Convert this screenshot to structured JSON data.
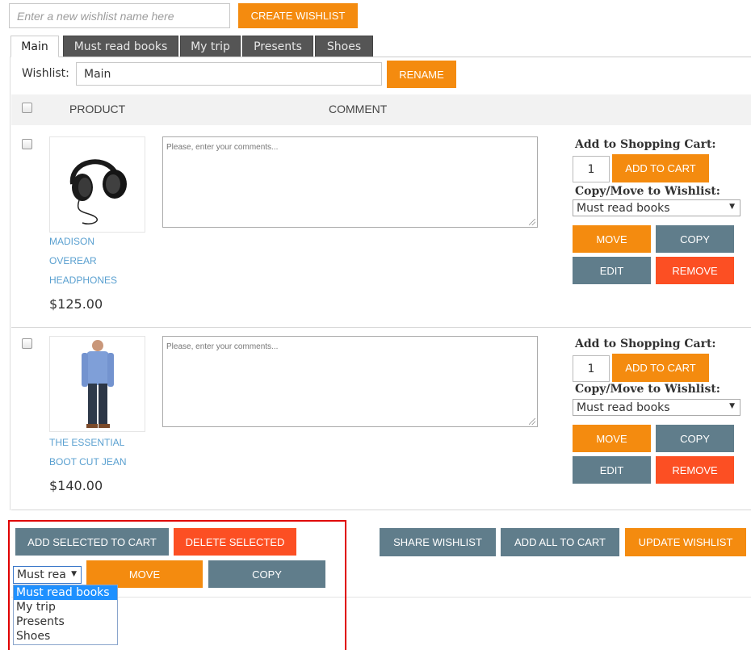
{
  "new_wishlist": {
    "placeholder": "Enter a new wishlist name here",
    "create_label": "CREATE WISHLIST"
  },
  "tabs": [
    "Main",
    "Must read books",
    "My trip",
    "Presents",
    "Shoes"
  ],
  "wishlist": {
    "label": "Wishlist:",
    "name": "Main",
    "rename_label": "RENAME"
  },
  "table_header": {
    "product": "PRODUCT",
    "comment": "COMMENT"
  },
  "items": [
    {
      "name_lines": [
        "MADISON",
        "OVEREAR",
        "HEADPHONES"
      ],
      "price": "$125.00",
      "comment_placeholder": "Please, enter your comments...",
      "add_to_cart_heading": "Add to Shopping Cart:",
      "qty": "1",
      "add_to_cart_label": "ADD TO CART",
      "copy_move_heading": "Copy/Move to Wishlist:",
      "target_wishlist": "Must read books",
      "move_label": "MOVE",
      "copy_label": "COPY",
      "edit_label": "EDIT",
      "remove_label": "REMOVE",
      "image_icon": "headphones-icon"
    },
    {
      "name_lines": [
        "THE ESSENTIAL",
        "BOOT CUT JEAN"
      ],
      "price": "$140.00",
      "comment_placeholder": "Please, enter your comments...",
      "add_to_cart_heading": "Add to Shopping Cart:",
      "qty": "1",
      "add_to_cart_label": "ADD TO CART",
      "copy_move_heading": "Copy/Move to Wishlist:",
      "target_wishlist": "Must read books",
      "move_label": "MOVE",
      "copy_label": "COPY",
      "edit_label": "EDIT",
      "remove_label": "REMOVE",
      "image_icon": "man-in-jeans-icon"
    }
  ],
  "bulk_actions": {
    "add_selected": "ADD SELECTED TO CART",
    "delete_selected": "DELETE SELECTED",
    "share": "SHARE WISHLIST",
    "add_all": "ADD ALL TO CART",
    "update": "UPDATE WISHLIST",
    "select_value": "Must rea",
    "move_label": "MOVE",
    "copy_label": "COPY",
    "dropdown_options": [
      "Must read books",
      "My trip",
      "Presents",
      "Shoes"
    ]
  },
  "colors": {
    "orange": "#f48b0f",
    "slate": "#607d8b",
    "red": "#fc4f23",
    "link": "#5aa0d0",
    "highlight": "#e00000"
  }
}
